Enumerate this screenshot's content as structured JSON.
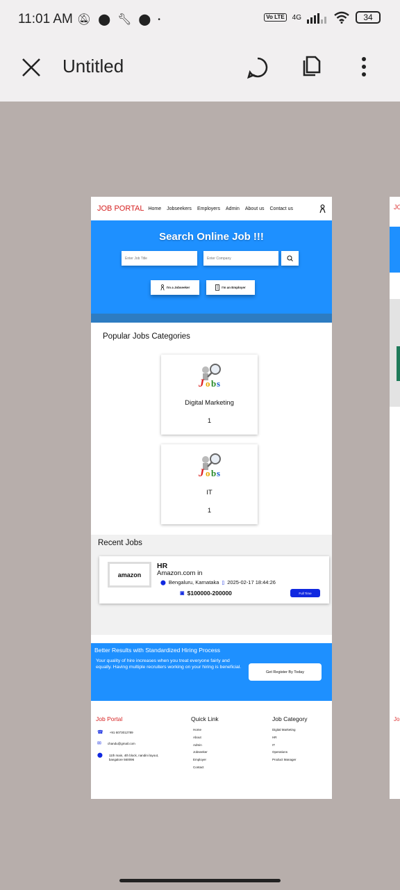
{
  "status_bar": {
    "time": "11:01 AM",
    "network": "4G",
    "volte": "Vo LTE",
    "battery": "34"
  },
  "app_bar": {
    "title": "Untitled",
    "icons": [
      "close-icon",
      "comment-icon",
      "copy-icon",
      "more-vert-icon"
    ]
  },
  "site": {
    "nav": {
      "brand": "JOB PORTAL",
      "links": [
        "Home",
        "Jobseekers",
        "Employers",
        "Admin",
        "About us",
        "Contact us"
      ]
    },
    "hero": {
      "title": "Search Online Job !!!",
      "job_title_placeholder": "Enter Job Title",
      "company_placeholder": "Enter Company",
      "jobseeker_button": "I'm a Jobseeker",
      "employer_button": "I'm an Employer"
    },
    "categories": {
      "heading": "Popular Jobs Categories",
      "items": [
        {
          "name": "Digital Marketing",
          "count": "1"
        },
        {
          "name": "IT",
          "count": "1"
        }
      ]
    },
    "recent": {
      "heading": "Recent Jobs",
      "jobs": [
        {
          "company_logo": "amazon",
          "title": "HR",
          "company": "Amazon.com in",
          "location": "Bengaluru, Karnataka",
          "posted": "2025-02-17  18:44:26",
          "salary": "$100000-200000",
          "type": "Full Time"
        }
      ]
    },
    "cta": {
      "title": "Better Results with Standardized Hiring Process",
      "text": "Your quality of hire increases when you treat everyone fairly and equally. Having multiple recruiters working on your hiring is beneficial.",
      "button": "Get Register By Today"
    },
    "footer": {
      "brand": "Job Portal",
      "phone": "+91 6073012789",
      "email": "chandu@gmail.com",
      "address": "11th main, 4th block, nandini layout, bangalore 560096",
      "quick_link_heading": "Quick Link",
      "quick_links": [
        "Home",
        "About",
        "Admin",
        "Jobseeker",
        "Employer",
        "Contact"
      ],
      "category_heading": "Job Category",
      "categories": [
        "Digital Marketing",
        "HR",
        "IT",
        "Operations",
        "Product Manager"
      ]
    }
  },
  "side_peek": {
    "brand_fragment": "JO",
    "footer_fragment": "Jo"
  },
  "colors": {
    "brand_red": "#d62222",
    "hero_blue": "#1e90ff",
    "job_type_blue": "#1028e0",
    "background": "#b7aeab"
  }
}
